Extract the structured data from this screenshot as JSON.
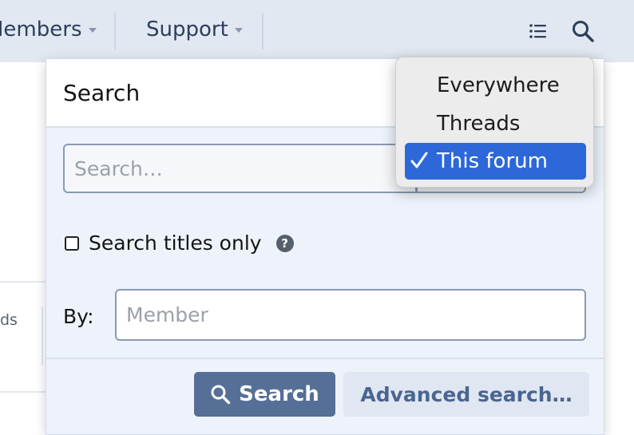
{
  "nav": {
    "members_label": "Members",
    "support_label": "Support"
  },
  "background": {
    "partial_text": "ds"
  },
  "search_menu": {
    "title": "Search",
    "keywords_placeholder": "Search…",
    "titles_only_label": "Search titles only",
    "help_glyph": "?",
    "by_label": "By:",
    "member_placeholder": "Member",
    "search_button": "Search",
    "advanced_button": "Advanced search…"
  },
  "scope_options": [
    {
      "label": "Everywhere",
      "selected": false
    },
    {
      "label": "Threads",
      "selected": false
    },
    {
      "label": "This forum",
      "selected": true
    }
  ],
  "colors": {
    "topbar": "#e2e8f2",
    "primary_button": "#566f96",
    "selection": "#2c68d8"
  },
  "icons": [
    "chevron-down-icon",
    "list-icon",
    "search-icon",
    "question-icon",
    "checkmark-icon"
  ]
}
